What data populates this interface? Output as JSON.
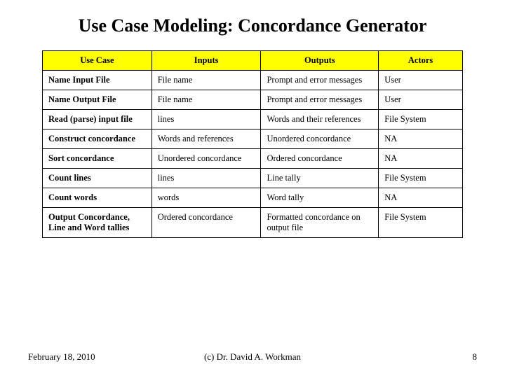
{
  "title": "Use Case Modeling: Concordance Generator",
  "table": {
    "headers": [
      "Use Case",
      "Inputs",
      "Outputs",
      "Actors"
    ],
    "rows": [
      {
        "c0": "Name Input File",
        "c1": "File name",
        "c2": "Prompt and error messages",
        "c3": "User"
      },
      {
        "c0": "Name Output File",
        "c1": "File name",
        "c2": "Prompt and error messages",
        "c3": "User"
      },
      {
        "c0": "Read (parse) input file",
        "c1": "lines",
        "c2": "Words and their references",
        "c3": "File System"
      },
      {
        "c0": "Construct concordance",
        "c1": "Words and references",
        "c2": "Unordered concordance",
        "c3": "NA"
      },
      {
        "c0": "Sort concordance",
        "c1": "Unordered concordance",
        "c2": "Ordered concordance",
        "c3": "NA"
      },
      {
        "c0": "Count lines",
        "c1": "lines",
        "c2": "Line tally",
        "c3": "File System"
      },
      {
        "c0": "Count words",
        "c1": "words",
        "c2": "Word tally",
        "c3": "NA"
      },
      {
        "c0": "Output Concordance, Line and Word tallies",
        "c1": "Ordered concordance",
        "c2": "Formatted concordance on output file",
        "c3": "File System"
      }
    ]
  },
  "footer": {
    "date": "February 18, 2010",
    "copyright": "(c) Dr. David A. Workman",
    "page": "8"
  }
}
